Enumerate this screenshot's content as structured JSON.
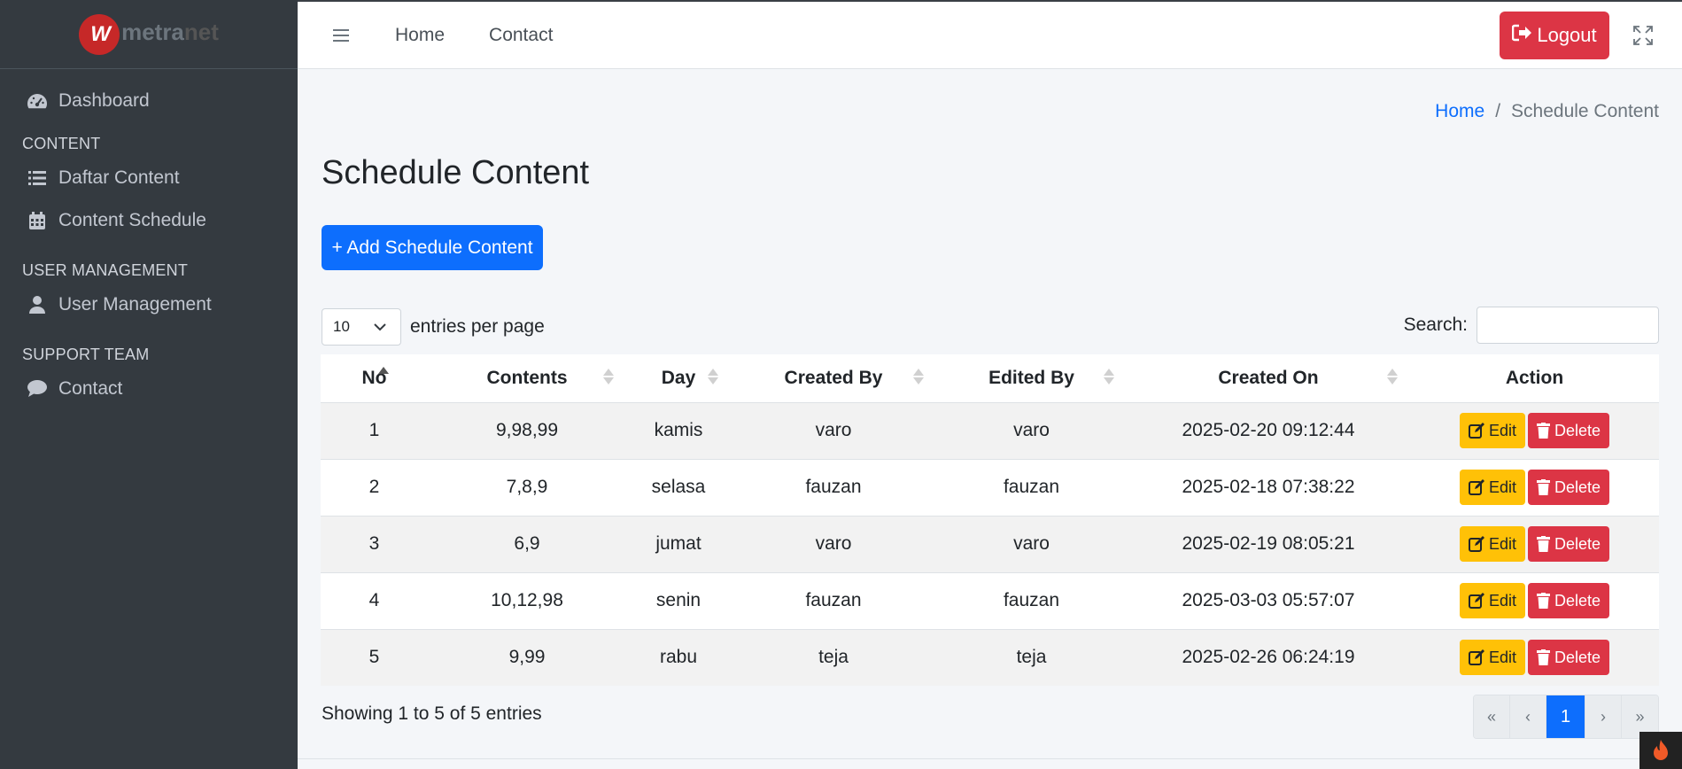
{
  "brand": {
    "logo_mark": "W",
    "logo_text_a": "metra",
    "logo_text_b": "net"
  },
  "sidebar": {
    "items": [
      {
        "label": "Dashboard",
        "icon": "dashboard-icon"
      },
      {
        "header": "CONTENT"
      },
      {
        "label": "Daftar Content",
        "icon": "list-icon"
      },
      {
        "label": "Content Schedule",
        "icon": "calendar-icon"
      },
      {
        "header": "USER MANAGEMENT"
      },
      {
        "label": "User Management",
        "icon": "user-icon"
      },
      {
        "header": "SUPPORT TEAM"
      },
      {
        "label": "Contact",
        "icon": "chat-icon"
      }
    ]
  },
  "topbar": {
    "home": "Home",
    "contact": "Contact",
    "logout": "Logout"
  },
  "breadcrumb": {
    "home": "Home",
    "separator": "/",
    "current": "Schedule Content"
  },
  "page": {
    "title": "Schedule Content",
    "add_button": "+ Add Schedule Content"
  },
  "table_controls": {
    "per_page": "10",
    "entries_label": "entries per page",
    "search_label": "Search:",
    "search_value": ""
  },
  "table": {
    "columns": [
      "No",
      "Contents",
      "Day",
      "Created By",
      "Edited By",
      "Created On",
      "Action"
    ],
    "rows": [
      {
        "no": "1",
        "contents": "9,98,99",
        "day": "kamis",
        "created_by": "varo",
        "edited_by": "varo",
        "created_on": "2025-02-20 09:12:44"
      },
      {
        "no": "2",
        "contents": "7,8,9",
        "day": "selasa",
        "created_by": "fauzan",
        "edited_by": "fauzan",
        "created_on": "2025-02-18 07:38:22"
      },
      {
        "no": "3",
        "contents": "6,9",
        "day": "jumat",
        "created_by": "varo",
        "edited_by": "varo",
        "created_on": "2025-02-19 08:05:21"
      },
      {
        "no": "4",
        "contents": "10,12,98",
        "day": "senin",
        "created_by": "fauzan",
        "edited_by": "fauzan",
        "created_on": "2025-03-03 05:57:07"
      },
      {
        "no": "5",
        "contents": "9,99",
        "day": "rabu",
        "created_by": "teja",
        "edited_by": "teja",
        "created_on": "2025-02-26 06:24:19"
      }
    ],
    "edit_label": "Edit",
    "delete_label": "Delete"
  },
  "footer": {
    "showing": "Showing 1 to 5 of 5 entries",
    "pager": {
      "first": "«",
      "prev": "‹",
      "current": "1",
      "next": "›",
      "last": "»"
    }
  },
  "colors": {
    "sidebar": "#343a40",
    "primary": "#0d6efd",
    "danger": "#dc3545",
    "warning": "#ffc107"
  }
}
